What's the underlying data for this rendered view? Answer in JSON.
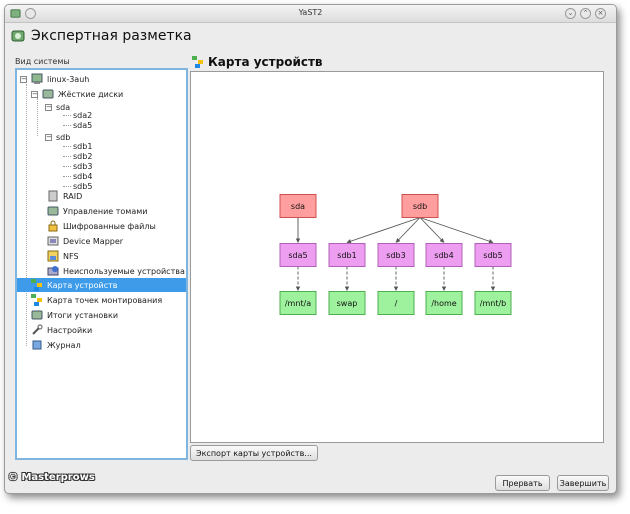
{
  "window": {
    "title": "YaST2"
  },
  "app": {
    "heading": "Экспертная разметка"
  },
  "sidebar": {
    "label": "Вид системы",
    "items": [
      {
        "label": "linux-3auh"
      },
      {
        "label": "Жёсткие диски"
      },
      {
        "label": "sda"
      },
      {
        "label": "sda2"
      },
      {
        "label": "sda5"
      },
      {
        "label": "sdb"
      },
      {
        "label": "sdb1"
      },
      {
        "label": "sdb2"
      },
      {
        "label": "sdb3"
      },
      {
        "label": "sdb4"
      },
      {
        "label": "sdb5"
      },
      {
        "label": "RAID"
      },
      {
        "label": "Управление томами"
      },
      {
        "label": "Шифрованные файлы"
      },
      {
        "label": "Device Mapper"
      },
      {
        "label": "NFS"
      },
      {
        "label": "Неиспользуемые устройства"
      },
      {
        "label": "Карта устройств"
      },
      {
        "label": "Карта точек монтирования"
      },
      {
        "label": "Итоги установки"
      },
      {
        "label": "Настройки"
      },
      {
        "label": "Журнал"
      }
    ]
  },
  "main": {
    "title": "Карта устройств",
    "graph": {
      "nodes": [
        {
          "id": "sda",
          "label": "sda",
          "kind": "disk"
        },
        {
          "id": "sdb",
          "label": "sdb",
          "kind": "disk"
        },
        {
          "id": "sda5",
          "label": "sda5",
          "kind": "partition"
        },
        {
          "id": "sdb1",
          "label": "sdb1",
          "kind": "partition"
        },
        {
          "id": "sdb3",
          "label": "sdb3",
          "kind": "partition"
        },
        {
          "id": "sdb4",
          "label": "sdb4",
          "kind": "partition"
        },
        {
          "id": "sdb5",
          "label": "sdb5",
          "kind": "partition"
        },
        {
          "id": "m_mnta",
          "label": "/mnt/a",
          "kind": "mount"
        },
        {
          "id": "m_swap",
          "label": "swap",
          "kind": "mount"
        },
        {
          "id": "m_root",
          "label": "/",
          "kind": "mount"
        },
        {
          "id": "m_home",
          "label": "/home",
          "kind": "mount"
        },
        {
          "id": "m_mntb",
          "label": "/mnt/b",
          "kind": "mount"
        }
      ],
      "edges": [
        {
          "from": "sda",
          "to": "sda5",
          "style": "solid"
        },
        {
          "from": "sdb",
          "to": "sdb1",
          "style": "solid"
        },
        {
          "from": "sdb",
          "to": "sdb3",
          "style": "solid"
        },
        {
          "from": "sdb",
          "to": "sdb4",
          "style": "solid"
        },
        {
          "from": "sdb",
          "to": "sdb5",
          "style": "solid"
        },
        {
          "from": "sda5",
          "to": "m_mnta",
          "style": "dashed"
        },
        {
          "from": "sdb1",
          "to": "m_swap",
          "style": "dashed"
        },
        {
          "from": "sdb3",
          "to": "m_root",
          "style": "dashed"
        },
        {
          "from": "sdb4",
          "to": "m_home",
          "style": "dashed"
        },
        {
          "from": "sdb5",
          "to": "m_mntb",
          "style": "dashed"
        }
      ],
      "colors": {
        "disk_fill": "#ff9e9e",
        "disk_stroke": "#d05050",
        "partition_fill": "#ee9ef0",
        "partition_stroke": "#b060b8",
        "mount_fill": "#9ef29e",
        "mount_stroke": "#4fae4f"
      }
    },
    "export_button": "Экспорт карты устройств..."
  },
  "footer": {
    "abort_button": "Прервать",
    "finish_button": "Завершить"
  },
  "watermark": "© Masterprows"
}
